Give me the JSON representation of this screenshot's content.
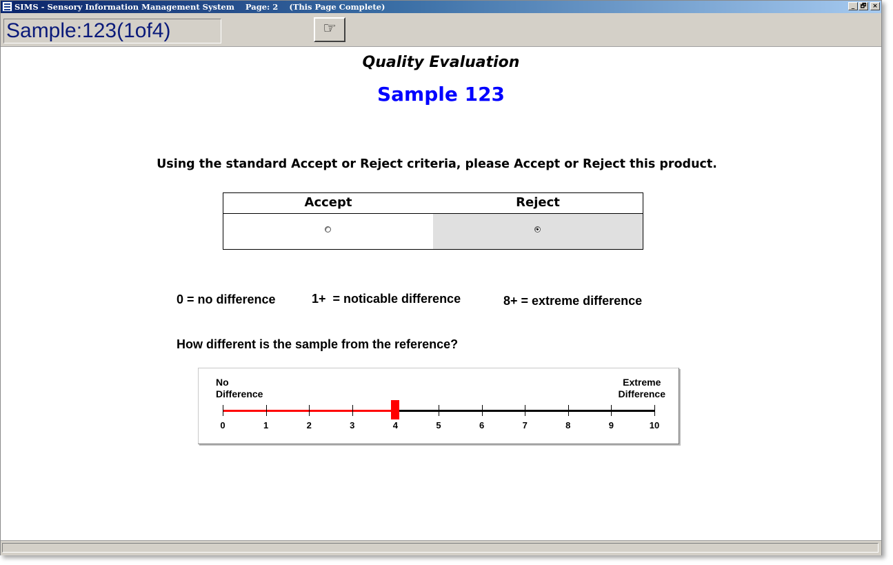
{
  "window": {
    "title": "SIMS - Sensory Information Management System    Page: 2    (This Page Complete)",
    "controls": [
      "_",
      "🗗",
      "×"
    ]
  },
  "toolbar": {
    "sample_label": "Sample:123(1of4)",
    "next_icon": "pointing-hand-icon",
    "next_glyph": "☞"
  },
  "page": {
    "heading": "Quality Evaluation",
    "sample_title": "Sample 123"
  },
  "accept_reject": {
    "question": "Using the standard Accept or Reject criteria, please Accept or Reject this product.",
    "options": [
      {
        "label": "Accept",
        "selected": false
      },
      {
        "label": "Reject",
        "selected": true
      }
    ]
  },
  "legend": {
    "items": [
      "0 = no difference",
      "1+  = noticable difference",
      "8+ = extreme difference"
    ]
  },
  "difference_scale": {
    "question": "How different is the sample from the reference?",
    "left_anchor_line1": "No",
    "left_anchor_line2": "Difference",
    "right_anchor_line1": "Extreme",
    "right_anchor_line2": "Difference",
    "min": 0,
    "max": 10,
    "ticks": [
      "0",
      "1",
      "2",
      "3",
      "4",
      "5",
      "6",
      "7",
      "8",
      "9",
      "10"
    ],
    "value": 4,
    "fill_color": "#ff0000"
  },
  "colors": {
    "title_accent": "#0000ff",
    "toolbar_bg": "#d4d0c8",
    "sample_text": "#0a1a7a"
  }
}
